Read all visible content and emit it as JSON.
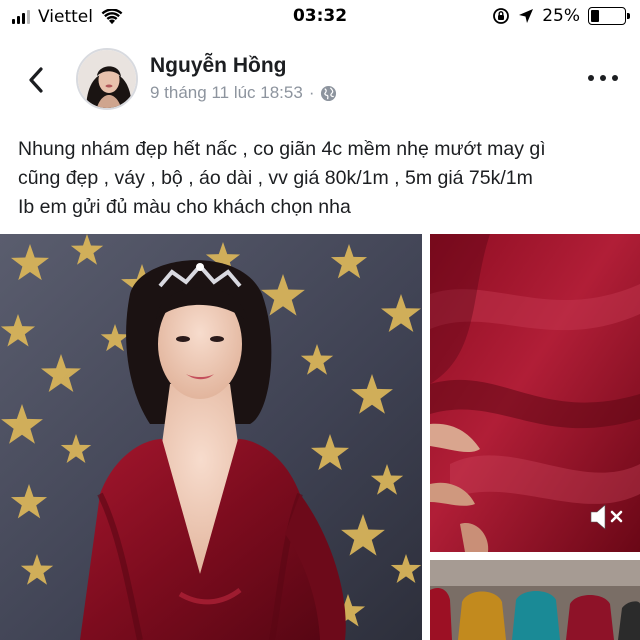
{
  "status_bar": {
    "carrier": "Viettel",
    "time": "03:32",
    "battery_percent": "25%",
    "battery_level": 0.25,
    "signal_bars": 4,
    "signal_bars_filled": 3
  },
  "header": {
    "back_icon": "chevron-left-icon",
    "author": "Nguyễn Hồng",
    "timestamp": "9 tháng 11 lúc 18:53",
    "separator": "·",
    "privacy_icon": "globe-icon",
    "more_icon": "more-horizontal-icon"
  },
  "post": {
    "text_lines": [
      "Nhung nhám đẹp hết nấc , co giãn 4c mềm nhẹ mướt may gì",
      "cũng đẹp , váy , bộ , áo dài , vv giá 80k/1m , 5m giá 75k/1m",
      "Ib em gửi đủ màu cho khách chọn nha"
    ]
  },
  "media": {
    "photos": [
      {
        "subject": "woman-in-red-velvet-dress",
        "icon": "photo-icon"
      },
      {
        "subject": "red-velvet-fabric-closeup",
        "icon": "photo-icon"
      },
      {
        "subject": "velvet-color-swatches",
        "icon": "photo-icon"
      }
    ],
    "mute_icon": "speaker-muted-icon"
  },
  "colors": {
    "text": "#1c1e21",
    "meta": "#8d949e",
    "velvet_red": "#8e0d22",
    "gold_star": "#d8b45a"
  }
}
